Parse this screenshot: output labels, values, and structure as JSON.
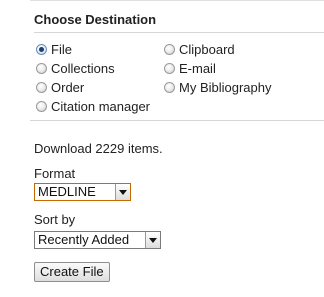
{
  "destination": {
    "heading": "Choose Destination",
    "options": [
      {
        "label": "File",
        "checked": true
      },
      {
        "label": "Clipboard",
        "checked": false
      },
      {
        "label": "Collections",
        "checked": false
      },
      {
        "label": "E-mail",
        "checked": false
      },
      {
        "label": "Order",
        "checked": false
      },
      {
        "label": "My Bibliography",
        "checked": false
      },
      {
        "label": "Citation manager",
        "checked": false
      }
    ]
  },
  "file": {
    "download_text": "Download 2229 items.",
    "format_label": "Format",
    "format_value": "MEDLINE",
    "sort_label": "Sort by",
    "sort_value": "Recently Added",
    "create_button": "Create File"
  },
  "colors": {
    "format_select_border": "#c56a00",
    "radio_checked": "#1e3f6e"
  }
}
